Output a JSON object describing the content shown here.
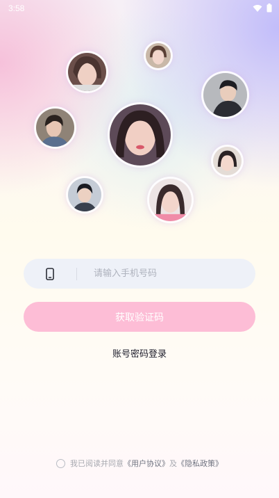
{
  "status_bar": {
    "time": "3:58",
    "icons": [
      "wifi-icon",
      "battery-icon"
    ]
  },
  "avatars": [
    {
      "name": "avatar-woman-1",
      "tone": "#c9a79a"
    },
    {
      "name": "avatar-woman-2",
      "tone": "#b89080"
    },
    {
      "name": "avatar-man-1",
      "tone": "#8a8f96"
    },
    {
      "name": "avatar-man-2",
      "tone": "#7f6e60"
    },
    {
      "name": "avatar-woman-3",
      "tone": "#c8867e"
    },
    {
      "name": "avatar-woman-4",
      "tone": "#b5978a"
    },
    {
      "name": "avatar-man-3",
      "tone": "#7c8693"
    },
    {
      "name": "avatar-woman-5",
      "tone": "#d29a95"
    }
  ],
  "login_form": {
    "phone_placeholder": "请输入手机号码",
    "phone_value": "",
    "get_code_label": "获取验证码",
    "password_login_label": "账号密码登录"
  },
  "agreement": {
    "prefix": "我已阅读并同意",
    "user_agreement": "《用户协议》",
    "conjunction": "及",
    "privacy_policy": "《隐私政策》"
  },
  "colors": {
    "button_pink": "#fdbdd6",
    "input_bg": "#eef1f8"
  }
}
